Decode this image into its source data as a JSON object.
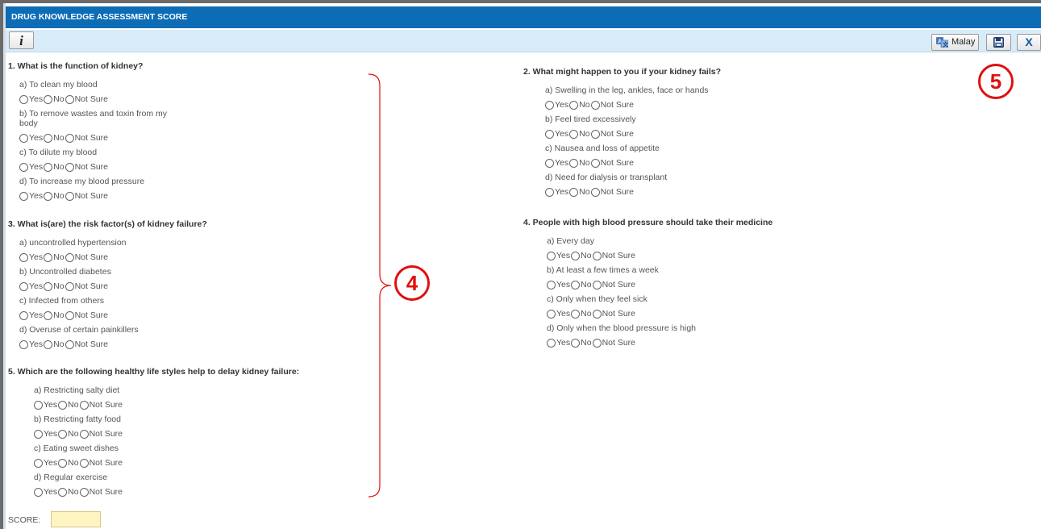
{
  "window": {
    "title": "DRUG KNOWLEDGE ASSESSMENT SCORE"
  },
  "toolbar": {
    "info_label": "i",
    "language_label": "Malay",
    "save_icon": "floppy-disk-icon",
    "close_label": "X"
  },
  "annotations": {
    "bracket_badge": "4",
    "toolbar_badge": "5"
  },
  "radio_labels": {
    "yes": "Yes",
    "no": "No",
    "not_sure": "Not Sure"
  },
  "questions": {
    "q1": {
      "title": "1. What is the function of kidney?",
      "options": [
        "a) To clean my blood",
        "b) To remove wastes and toxin from my body",
        "c) To dilute my blood",
        "d) To increase my blood pressure"
      ]
    },
    "q2": {
      "title": "2. What might happen to you if your kidney fails?",
      "options": [
        "a) Swelling in the leg, ankles, face or hands",
        "b) Feel tired excessively",
        "c) Nausea and loss of appetite",
        "d) Need for dialysis or transplant"
      ]
    },
    "q3": {
      "title": "3. What is(are) the risk factor(s) of kidney failure?",
      "options": [
        "a) uncontrolled hypertension",
        "b) Uncontrolled diabetes",
        "c) Infected from others",
        "d) Overuse of certain painkillers"
      ]
    },
    "q4": {
      "title": "4. People with high blood pressure should take their medicine",
      "options": [
        "a) Every day",
        "b) At least a few times a week",
        "c) Only when they feel sick",
        "d) Only when the blood pressure is high"
      ]
    },
    "q5": {
      "title": "5. Which are the following healthy life styles help to delay kidney failure:",
      "options": [
        "a) Restricting salty diet",
        "b) Restricting fatty food",
        "c) Eating sweet dishes",
        "d) Regular exercise"
      ]
    }
  },
  "score": {
    "label": "SCORE:",
    "value": ""
  }
}
